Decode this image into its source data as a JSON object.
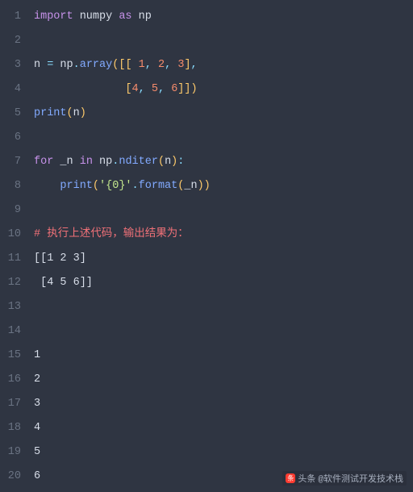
{
  "lines": [
    {
      "n": 1,
      "tokens": [
        [
          "kw",
          "import"
        ],
        [
          "id",
          " numpy "
        ],
        [
          "kw",
          "as"
        ],
        [
          "id",
          " np"
        ]
      ]
    },
    {
      "n": 2,
      "tokens": []
    },
    {
      "n": 3,
      "tokens": [
        [
          "id",
          "n "
        ],
        [
          "op",
          "="
        ],
        [
          "id",
          " np"
        ],
        [
          "op",
          "."
        ],
        [
          "fn",
          "array"
        ],
        [
          "pn",
          "([["
        ],
        [
          "id",
          " "
        ],
        [
          "num",
          "1"
        ],
        [
          "op",
          ","
        ],
        [
          "id",
          " "
        ],
        [
          "num",
          "2"
        ],
        [
          "op",
          ","
        ],
        [
          "id",
          " "
        ],
        [
          "num",
          "3"
        ],
        [
          "pn",
          "]"
        ],
        [
          "op",
          ","
        ]
      ]
    },
    {
      "n": 4,
      "tokens": [
        [
          "id",
          "              "
        ],
        [
          "pn",
          "["
        ],
        [
          "num",
          "4"
        ],
        [
          "op",
          ","
        ],
        [
          "id",
          " "
        ],
        [
          "num",
          "5"
        ],
        [
          "op",
          ","
        ],
        [
          "id",
          " "
        ],
        [
          "num",
          "6"
        ],
        [
          "pn",
          "]])"
        ]
      ]
    },
    {
      "n": 5,
      "tokens": [
        [
          "fn",
          "print"
        ],
        [
          "pn",
          "("
        ],
        [
          "id",
          "n"
        ],
        [
          "pn",
          ")"
        ]
      ]
    },
    {
      "n": 6,
      "tokens": []
    },
    {
      "n": 7,
      "tokens": [
        [
          "kw",
          "for"
        ],
        [
          "id",
          " _n "
        ],
        [
          "kw",
          "in"
        ],
        [
          "id",
          " np"
        ],
        [
          "op",
          "."
        ],
        [
          "fn",
          "nditer"
        ],
        [
          "pn",
          "("
        ],
        [
          "id",
          "n"
        ],
        [
          "pn",
          ")"
        ],
        [
          "op",
          ":"
        ]
      ]
    },
    {
      "n": 8,
      "tokens": [
        [
          "id",
          "    "
        ],
        [
          "fn",
          "print"
        ],
        [
          "pn",
          "("
        ],
        [
          "str",
          "'{0}'"
        ],
        [
          "op",
          "."
        ],
        [
          "fn",
          "format"
        ],
        [
          "pn",
          "("
        ],
        [
          "id",
          "_n"
        ],
        [
          "pn",
          "))"
        ]
      ]
    },
    {
      "n": 9,
      "tokens": []
    },
    {
      "n": 10,
      "tokens": [
        [
          "cmt",
          "# 执行上述代码，输出结果为："
        ]
      ]
    },
    {
      "n": 11,
      "tokens": [
        [
          "out",
          "[[1 2 3]"
        ]
      ]
    },
    {
      "n": 12,
      "tokens": [
        [
          "out",
          " [4 5 6]]"
        ]
      ]
    },
    {
      "n": 13,
      "tokens": []
    },
    {
      "n": 14,
      "tokens": []
    },
    {
      "n": 15,
      "tokens": [
        [
          "out",
          "1"
        ]
      ]
    },
    {
      "n": 16,
      "tokens": [
        [
          "out",
          "2"
        ]
      ]
    },
    {
      "n": 17,
      "tokens": [
        [
          "out",
          "3"
        ]
      ]
    },
    {
      "n": 18,
      "tokens": [
        [
          "out",
          "4"
        ]
      ]
    },
    {
      "n": 19,
      "tokens": [
        [
          "out",
          "5"
        ]
      ]
    },
    {
      "n": 20,
      "tokens": [
        [
          "out",
          "6"
        ]
      ]
    }
  ],
  "watermark": {
    "prefix": "头条",
    "text": "@软件测试开发技术栈"
  }
}
